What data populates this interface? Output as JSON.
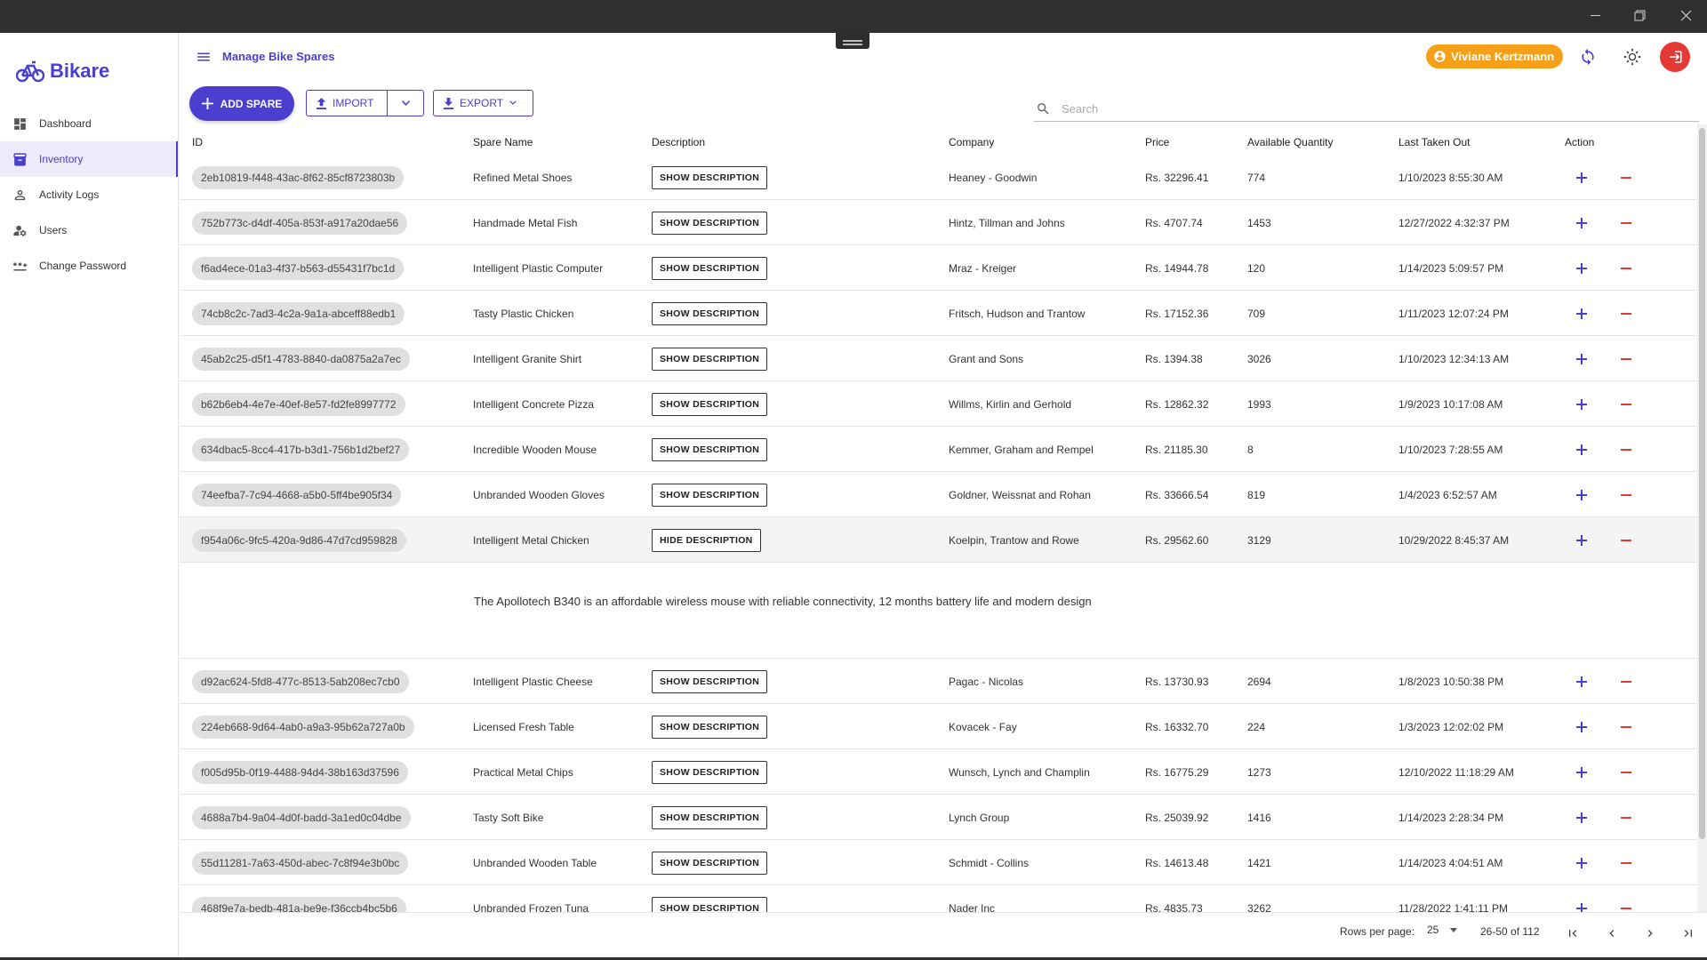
{
  "brand": {
    "name": "Bikare",
    "color": "#4a3fcf"
  },
  "header": {
    "title": "Manage Bike Spares",
    "user": "Viviane Kertzmann"
  },
  "sidebar": {
    "items": [
      {
        "label": "Dashboard",
        "icon": "dashboard-icon"
      },
      {
        "label": "Inventory",
        "icon": "inventory-icon",
        "active": true
      },
      {
        "label": "Activity Logs",
        "icon": "person-icon"
      },
      {
        "label": "Users",
        "icon": "users-icon"
      },
      {
        "label": "Change Password",
        "icon": "password-icon"
      }
    ]
  },
  "toolbar": {
    "add_label": "ADD SPARE",
    "import_label": "IMPORT",
    "export_label": "EXPORT",
    "search_placeholder": "Search"
  },
  "table": {
    "columns": [
      "ID",
      "Spare Name",
      "Description",
      "Company",
      "Price",
      "Available Quantity",
      "Last Taken Out",
      "Action"
    ],
    "show_label": "SHOW DESCRIPTION",
    "hide_label": "HIDE DESCRIPTION",
    "expanded_text": "The Apollotech B340 is an affordable wireless mouse with reliable connectivity, 12 months battery life and modern design",
    "rows": [
      {
        "id": "2eb10819-f448-43ac-8f62-85cf8723803b",
        "name": "Refined Metal Shoes",
        "company": "Heaney - Goodwin",
        "price": "Rs. 32296.41",
        "qty": "774",
        "last": "1/10/2023 8:55:30 AM"
      },
      {
        "id": "752b773c-d4df-405a-853f-a917a20dae56",
        "name": "Handmade Metal Fish",
        "company": "Hintz, Tillman and Johns",
        "price": "Rs. 4707.74",
        "qty": "1453",
        "last": "12/27/2022 4:32:37 PM"
      },
      {
        "id": "f6ad4ece-01a3-4f37-b563-d55431f7bc1d",
        "name": "Intelligent Plastic Computer",
        "company": "Mraz - Kreiger",
        "price": "Rs. 14944.78",
        "qty": "120",
        "last": "1/14/2023 5:09:57 PM"
      },
      {
        "id": "74cb8c2c-7ad3-4c2a-9a1a-abceff88edb1",
        "name": "Tasty Plastic Chicken",
        "company": "Fritsch, Hudson and Trantow",
        "price": "Rs. 17152.36",
        "qty": "709",
        "last": "1/11/2023 12:07:24 PM"
      },
      {
        "id": "45ab2c25-d5f1-4783-8840-da0875a2a7ec",
        "name": "Intelligent Granite Shirt",
        "company": "Grant and Sons",
        "price": "Rs. 1394.38",
        "qty": "3026",
        "last": "1/10/2023 12:34:13 AM"
      },
      {
        "id": "b62b6eb4-4e7e-40ef-8e57-fd2fe8997772",
        "name": "Intelligent Concrete Pizza",
        "company": "Willms, Kirlin and Gerhold",
        "price": "Rs. 12862.32",
        "qty": "1993",
        "last": "1/9/2023 10:17:08 AM"
      },
      {
        "id": "634dbac5-8cc4-417b-b3d1-756b1d2bef27",
        "name": "Incredible Wooden Mouse",
        "company": "Kemmer, Graham and Rempel",
        "price": "Rs. 21185.30",
        "qty": "8",
        "last": "1/10/2023 7:28:55 AM"
      },
      {
        "id": "74eefba7-7c94-4668-a5b0-5ff4be905f34",
        "name": "Unbranded Wooden Gloves",
        "company": "Goldner, Weissnat and Rohan",
        "price": "Rs. 33666.54",
        "qty": "819",
        "last": "1/4/2023 6:52:57 AM"
      },
      {
        "id": "f954a06c-9fc5-420a-9d86-47d7cd959828",
        "name": "Intelligent Metal Chicken",
        "company": "Koelpin, Trantow and Rowe",
        "price": "Rs. 29562.60",
        "qty": "3129",
        "last": "10/29/2022 8:45:37 AM",
        "expanded": true
      },
      {
        "id": "d92ac624-5fd8-477c-8513-5ab208ec7cb0",
        "name": "Intelligent Plastic Cheese",
        "company": "Pagac - Nicolas",
        "price": "Rs. 13730.93",
        "qty": "2694",
        "last": "1/8/2023 10:50:38 PM"
      },
      {
        "id": "224eb668-9d64-4ab0-a9a3-95b62a727a0b",
        "name": "Licensed Fresh Table",
        "company": "Kovacek - Fay",
        "price": "Rs. 16332.70",
        "qty": "224",
        "last": "1/3/2023 12:02:02 PM"
      },
      {
        "id": "f005d95b-0f19-4488-94d4-38b163d37596",
        "name": "Practical Metal Chips",
        "company": "Wunsch, Lynch and Champlin",
        "price": "Rs. 16775.29",
        "qty": "1273",
        "last": "12/10/2022 11:18:29 AM"
      },
      {
        "id": "4688a7b4-9a04-4d0f-badd-3a1ed0c04dbe",
        "name": "Tasty Soft Bike",
        "company": "Lynch Group",
        "price": "Rs. 25039.92",
        "qty": "1416",
        "last": "1/14/2023 2:28:34 PM"
      },
      {
        "id": "55d11281-7a63-450d-abec-7c8f94e3b0bc",
        "name": "Unbranded Wooden Table",
        "company": "Schmidt - Collins",
        "price": "Rs. 14613.48",
        "qty": "1421",
        "last": "1/14/2023 4:04:51 AM"
      },
      {
        "id": "468f9e7a-bedb-481a-be9e-f36ccb4bc5b6",
        "name": "Unbranded Frozen Tuna",
        "company": "Nader Inc",
        "price": "Rs. 4835.73",
        "qty": "3262",
        "last": "11/28/2022 1:41:11 PM"
      }
    ]
  },
  "pagination": {
    "rows_label": "Rows per page:",
    "rows_value": "25",
    "range": "26-50 of 112"
  },
  "colors": {
    "accent": "#4a3fcf",
    "user_chip": "#f6a019",
    "logout": "#e53935",
    "remove": "#e53935"
  }
}
